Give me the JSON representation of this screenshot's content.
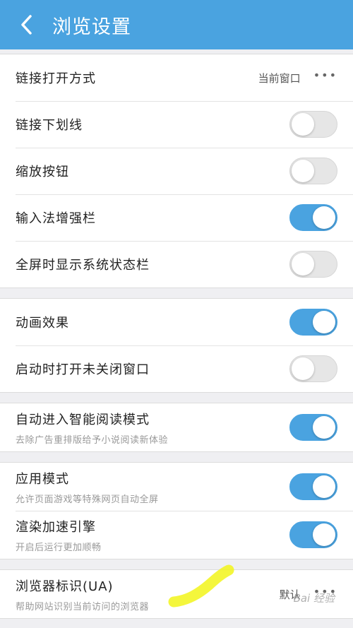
{
  "header": {
    "title": "浏览设置",
    "back_icon": "chevron-left-icon",
    "color": "#4aa3e0"
  },
  "groups": [
    {
      "rows": [
        {
          "label": "链接打开方式",
          "value": "当前窗口",
          "control": "more"
        },
        {
          "label": "链接下划线",
          "control": "toggle",
          "on": false
        },
        {
          "label": "缩放按钮",
          "control": "toggle",
          "on": false
        },
        {
          "label": "输入法增强栏",
          "control": "toggle",
          "on": true
        },
        {
          "label": "全屏时显示系统状态栏",
          "control": "toggle",
          "on": false
        }
      ]
    },
    {
      "rows": [
        {
          "label": "动画效果",
          "control": "toggle",
          "on": true
        },
        {
          "label": "启动时打开未关闭窗口",
          "control": "toggle",
          "on": false
        }
      ]
    },
    {
      "rows": [
        {
          "label": "自动进入智能阅读模式",
          "sub": "去除广告重排版给予小说阅读新体验",
          "control": "toggle",
          "on": true
        }
      ]
    },
    {
      "rows": [
        {
          "label": "应用模式",
          "sub": "允许页面游戏等特殊网页自动全屏",
          "control": "toggle",
          "on": true
        },
        {
          "label": "渲染加速引擎",
          "sub": "开启后运行更加顺畅",
          "control": "toggle",
          "on": true
        }
      ]
    },
    {
      "rows": [
        {
          "label": "浏览器标识(UA)",
          "sub": "帮助网站识别当前访问的浏览器",
          "value": "默认",
          "control": "more"
        }
      ]
    }
  ],
  "more_glyph": "•••",
  "watermark": "Bai 经验",
  "highlight_color": "#f2f51a",
  "toggle_on_color": "#4aa3e0"
}
